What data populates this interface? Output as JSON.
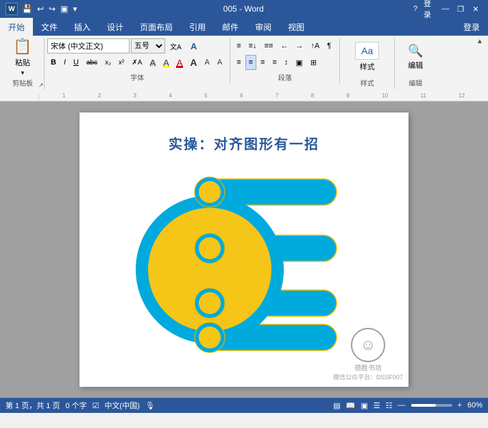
{
  "titlebar": {
    "title": "005 - Word",
    "app_icon": "W",
    "quick_access": [
      "save",
      "undo",
      "redo",
      "customize"
    ],
    "controls": [
      "minimize",
      "restore",
      "close"
    ],
    "help_label": "?",
    "login_label": "登录"
  },
  "ribbon": {
    "tabs": [
      "文件",
      "开始",
      "插入",
      "设计",
      "页面布局",
      "引用",
      "邮件",
      "审阅",
      "视图"
    ],
    "active_tab": "开始",
    "groups": {
      "clipboard": {
        "label": "剪贴板",
        "paste": "粘贴"
      },
      "font": {
        "label": "字体",
        "font_name": "宋体 (中文正文)",
        "font_size": "五号",
        "size_number": "",
        "bold": "B",
        "italic": "I",
        "underline": "U",
        "strikethrough": "abc",
        "subscript": "x₂",
        "superscript": "x²",
        "clear_format": "A",
        "text_effect": "A",
        "highlight": "A",
        "font_color": "A",
        "font_size_large": "A",
        "font_size_small": "A",
        "char_spacing": "A"
      },
      "paragraph": {
        "label": "段落",
        "bullets": "≡",
        "numbering": "≡",
        "multilevel": "≡",
        "decrease_indent": "←",
        "increase_indent": "→",
        "sort": "↑A",
        "show_marks": "¶",
        "align_left": "≡",
        "align_center": "≡",
        "align_right": "≡",
        "justify": "≡",
        "line_spacing": "≡",
        "shading": "□",
        "borders": "□"
      },
      "styles": {
        "label": "样式",
        "btn": "样式"
      },
      "editing": {
        "label": "编辑",
        "btn": "编辑"
      }
    }
  },
  "document": {
    "title": "实操：对齐图形有一招",
    "page_info": "第 1 页，共 1 页",
    "word_count": "0 个字",
    "language": "中文(中国)",
    "zoom": "60%"
  },
  "statusbar": {
    "page": "第 1 页，共 1 页",
    "words": "0 个字",
    "lang": "中文(中国)",
    "layout_btns": [
      "普通",
      "阅读",
      "页面布局",
      "大纲",
      "草稿"
    ],
    "zoom_pct": "60%"
  },
  "watermark": {
    "icon": "☺",
    "line1": "德胜书坊",
    "line2": "微信公众平台：DSSF007"
  },
  "graphic": {
    "big_circle_fill": "#f5c518",
    "big_circle_stroke": "#00aadc",
    "small_circles_fill": "#f5c518",
    "bars_fill": "#00aadc",
    "bars_stroke": "#e8b800",
    "bar_count": 4
  }
}
